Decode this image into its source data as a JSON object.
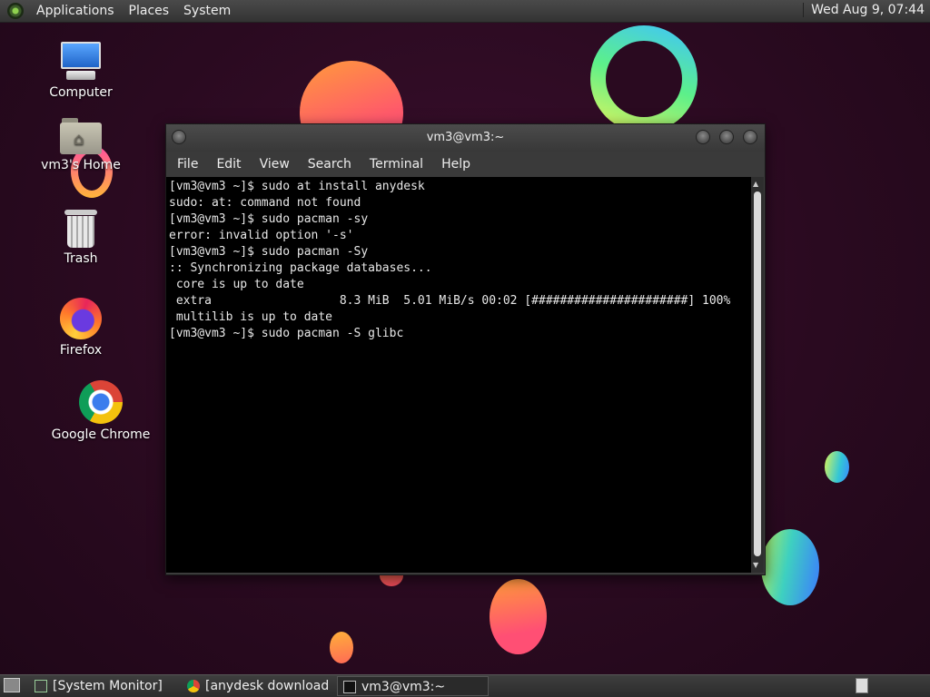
{
  "top_panel": {
    "menus": [
      "Applications",
      "Places",
      "System"
    ],
    "clock": "Wed Aug  9, 07:44"
  },
  "desktop_icons": {
    "computer": "Computer",
    "home": "vm3's Home",
    "trash": "Trash",
    "firefox": "Firefox",
    "chrome": "Google Chrome"
  },
  "terminal": {
    "title": "vm3@vm3:~",
    "menu": [
      "File",
      "Edit",
      "View",
      "Search",
      "Terminal",
      "Help"
    ],
    "lines": [
      "[vm3@vm3 ~]$ sudo at install anydesk",
      "sudo: at: command not found",
      "[vm3@vm3 ~]$ sudo pacman -sy",
      "error: invalid option '-s'",
      "[vm3@vm3 ~]$ sudo pacman -Sy",
      ":: Synchronizing package databases...",
      " core is up to date",
      " extra                  8.3 MiB  5.01 MiB/s 00:02 [######################] 100%",
      " multilib is up to date",
      "[vm3@vm3 ~]$ sudo pacman -S glibc"
    ]
  },
  "taskbar": {
    "tasks": [
      "[System Monitor]",
      "[anydesk download ...",
      "vm3@vm3:~"
    ]
  }
}
